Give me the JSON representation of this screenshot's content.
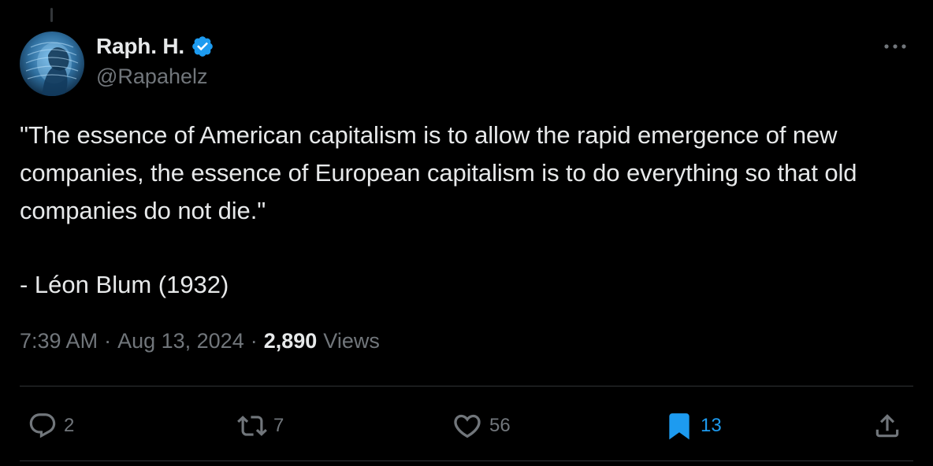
{
  "tweet": {
    "author": {
      "display_name": "Raph. H.",
      "handle": "@Rapahelz",
      "verified": true
    },
    "text": "\"The essence of American capitalism is to allow the rapid emergence of new companies, the essence of European capitalism is to do everything so that old companies do not die.\"",
    "attribution": "- Léon Blum (1932)",
    "time": "7:39 AM",
    "date": "Aug 13, 2024",
    "separator": "·",
    "views_count": "2,890",
    "views_label": "Views"
  },
  "actions": {
    "reply_count": "2",
    "repost_count": "7",
    "like_count": "56",
    "bookmark_count": "13"
  },
  "icons": {
    "verified": "verified-badge-icon",
    "more": "more-dots-icon",
    "reply": "speech-bubble-icon",
    "repost": "repost-arrows-icon",
    "like": "heart-icon",
    "bookmark": "bookmark-icon",
    "share": "share-upload-icon"
  },
  "colors": {
    "background": "#000000",
    "text_primary": "#e7e9ea",
    "text_secondary": "#71767b",
    "accent": "#1d9bf0",
    "divider": "#2f3336"
  }
}
